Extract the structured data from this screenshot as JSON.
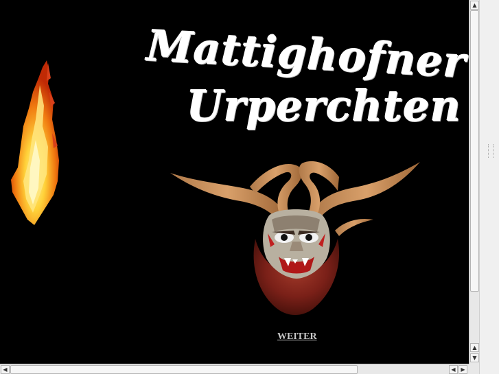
{
  "page": {
    "title_line_1": "Mattighofner",
    "title_line_2": "Urperchten",
    "link_label": "WEITER"
  },
  "images": {
    "flame": "flame-animation",
    "mask": "krampus-horned-mask"
  },
  "colors": {
    "background": "#000000",
    "title_text": "#ffffff",
    "link": "#c8c8c8",
    "scrollbar_track": "#e8e8e8"
  },
  "scrollbars": {
    "vertical_up_icon": "up-arrow-icon",
    "vertical_down_icon": "down-arrow-icon",
    "horizontal_left_icon": "left-arrow-icon",
    "horizontal_right_icon": "right-arrow-icon"
  }
}
